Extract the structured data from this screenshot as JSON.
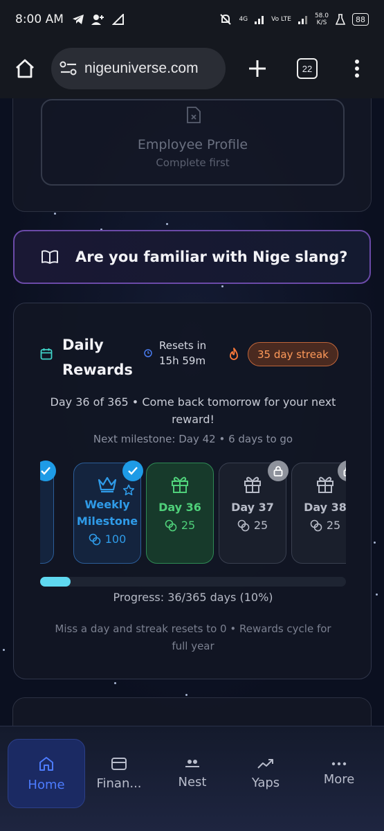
{
  "status_bar": {
    "time": "8:00 AM",
    "network": "4G",
    "volte": "Vo LTE",
    "speed": "58.0",
    "speed_unit": "K/S",
    "battery": "88"
  },
  "browser": {
    "url": "nigeuniverse.com",
    "tab_count": "22"
  },
  "employee_card": {
    "title": "Employee Profile",
    "subtitle": "Complete first"
  },
  "slang_banner": {
    "text": "Are you familiar with Nige slang?"
  },
  "daily_rewards": {
    "title": "Daily Rewards",
    "resets_label": "Resets in",
    "resets_time": "15h 59m",
    "streak": "35 day streak",
    "status": "Day 36 of 365 • Come back tomorrow for your next reward!",
    "milestone": "Next milestone: Day 42 • 6 days to go",
    "progress_fraction": 0.1,
    "progress_text": "Progress: 36/365 days (10%)",
    "note": "Miss a day and streak resets to 0 • Rewards cycle for full year",
    "days": [
      {
        "label": "",
        "reward": "",
        "state": "past"
      },
      {
        "label": "Weekly Milestone",
        "reward": "100",
        "state": "past"
      },
      {
        "label": "Day 36",
        "reward": "25",
        "state": "today"
      },
      {
        "label": "Day 37",
        "reward": "25",
        "state": "locked"
      },
      {
        "label": "Day 38",
        "reward": "25",
        "state": "locked"
      }
    ]
  },
  "bottom_nav": [
    {
      "label": "Home",
      "icon": "home-icon",
      "active": true
    },
    {
      "label": "Finan...",
      "icon": "card-icon",
      "active": false
    },
    {
      "label": "Nest",
      "icon": "nest-icon",
      "active": false
    },
    {
      "label": "Yaps",
      "icon": "trending-icon",
      "active": false
    },
    {
      "label": "More",
      "icon": "more-icon",
      "active": false
    }
  ],
  "colors": {
    "accent_blue": "#1e9be6",
    "today_green": "#4fd07a",
    "streak_orange": "#ff9a5a",
    "progress": "#5fd8f0",
    "slang_border": "#6b4aa8"
  }
}
